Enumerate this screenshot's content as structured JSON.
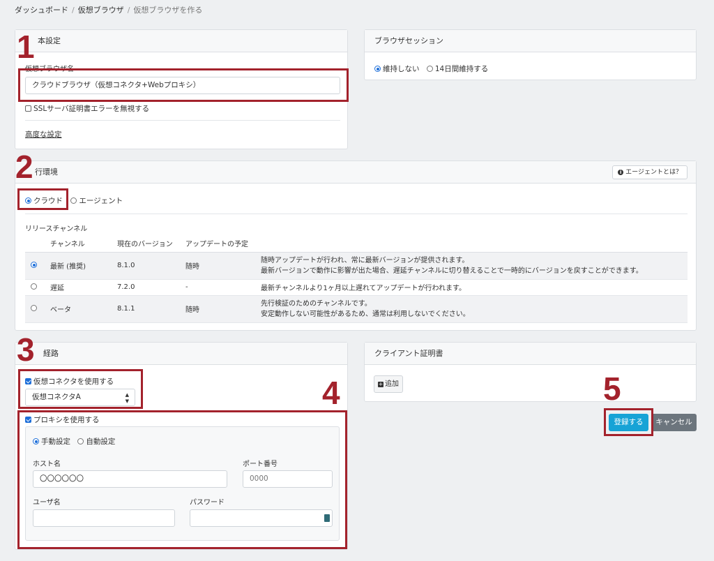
{
  "breadcrumb": [
    "ダッシュボード",
    "仮想ブラウザ",
    "仮想ブラウザを作る"
  ],
  "basic": {
    "header": "本設定",
    "name_label": "仮想ブラウザ名",
    "name_value": "クラウドブラウザ（仮想コネクタ+Webプロキシ）",
    "ssl_label": "SSLサーバ証明書エラーを無視する",
    "advanced_link": "高度な設定"
  },
  "session": {
    "header": "ブラウザセッション",
    "options": [
      "維持しない",
      "14日間維持する"
    ]
  },
  "env": {
    "header": "行環境",
    "agent_help": "エージェントとは？",
    "options": [
      "クラウド",
      "エージェント"
    ],
    "release_label": "リリースチャンネル",
    "columns": [
      "チャンネル",
      "現在のバージョン",
      "アップデートの予定"
    ],
    "rows": [
      {
        "channel": "最新 (推奨)",
        "version": "8.1.0",
        "schedule": "随時",
        "desc1": "随時アップデートが行われ、常に最新バージョンが提供されます。",
        "desc2": "最新バージョンで動作に影響が出た場合、遅延チャンネルに切り替えることで一時的にバージョンを戻すことができます。"
      },
      {
        "channel": "遅延",
        "version": "7.2.0",
        "schedule": "-",
        "desc1": "最新チャンネルより1ヶ月以上遅れてアップデートが行われます。",
        "desc2": ""
      },
      {
        "channel": "ベータ",
        "version": "8.1.1",
        "schedule": "随時",
        "desc1": "先行検証のためのチャンネルです。",
        "desc2": "安定動作しない可能性があるため、通常は利用しないでください。"
      }
    ]
  },
  "route": {
    "header": "経路",
    "connector_label": "仮想コネクタを使用する",
    "connector_value": "仮想コネクタA",
    "proxy_label": "プロキシを使用する",
    "proxy_modes": [
      "手動設定",
      "自動設定"
    ],
    "host_label": "ホスト名",
    "host_value": "〇〇〇〇〇〇",
    "port_label": "ポート番号",
    "port_placeholder": "0000",
    "user_label": "ユーザ名",
    "pass_label": "パスワード"
  },
  "client_cert": {
    "header": "クライアント証明書",
    "add_label": "追加"
  },
  "actions": {
    "submit": "登録する",
    "cancel": "キャンセル"
  },
  "annotations": [
    "1",
    "2",
    "3",
    "4",
    "5"
  ]
}
